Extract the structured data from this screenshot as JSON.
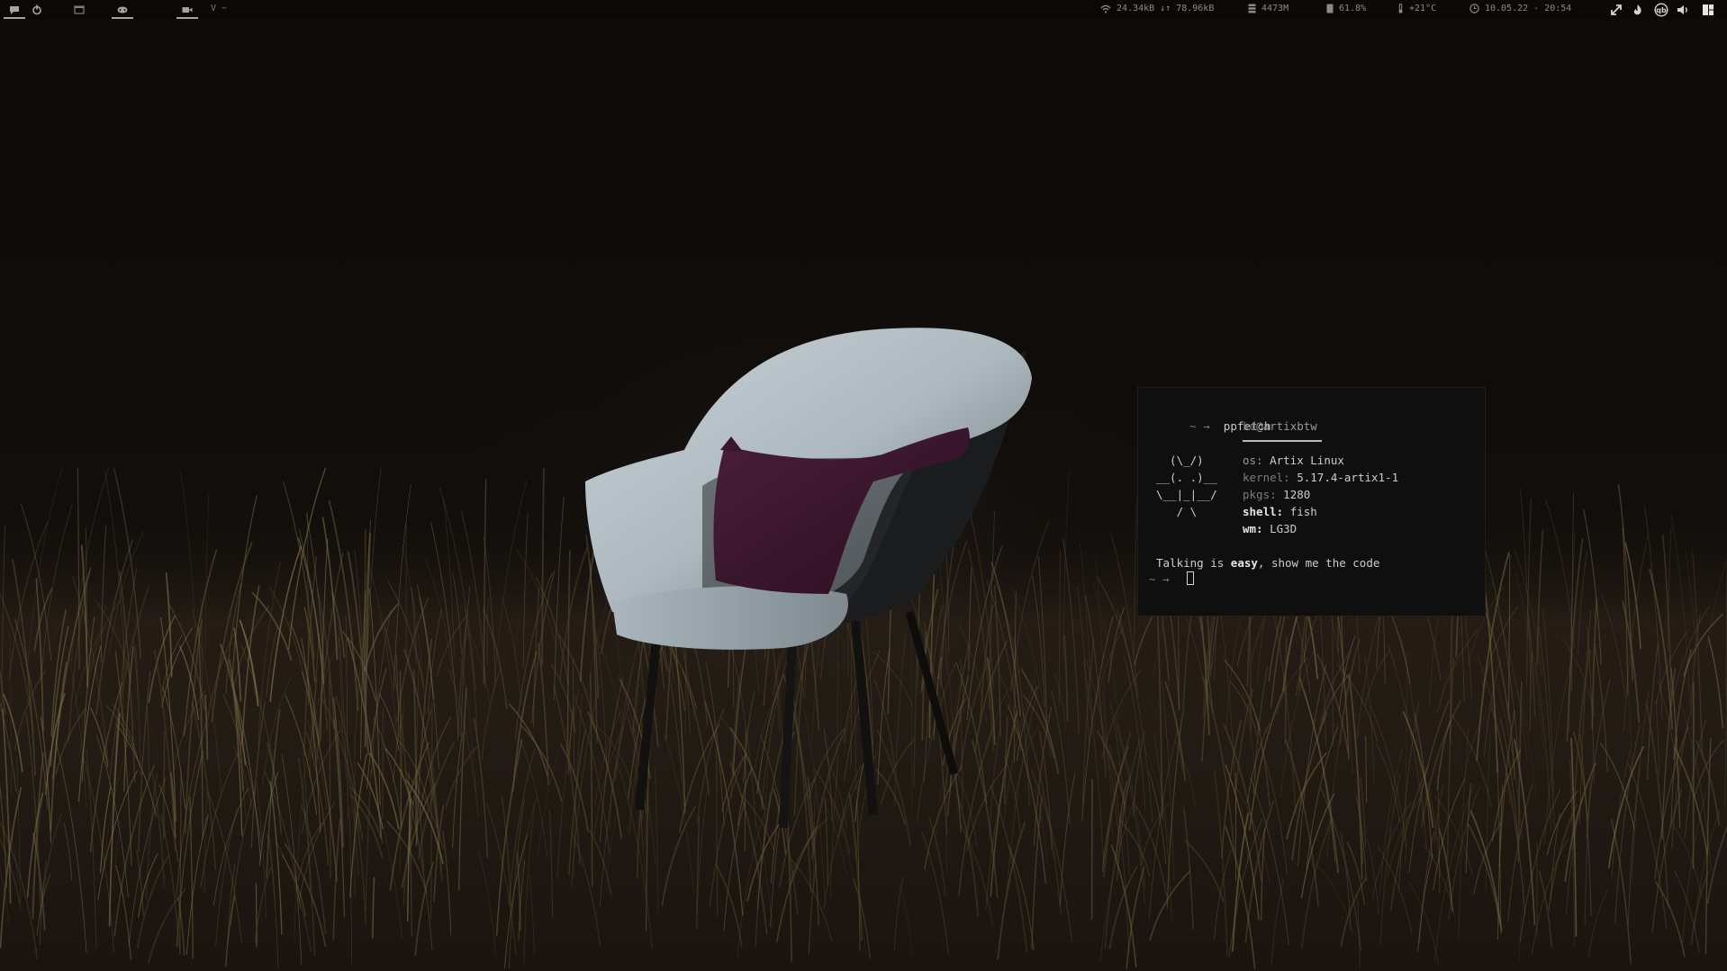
{
  "topbar": {
    "workspaces": [
      {
        "icon": "chat-icon",
        "active": true
      },
      {
        "icon": "power-icon",
        "active": false
      },
      {
        "icon": "window-icon",
        "active": false
      },
      {
        "icon": "game-icon",
        "active": true
      },
      {
        "icon": "video-icon",
        "active": true
      }
    ],
    "window_title": "V ~",
    "network": {
      "icon": "wifi-icon",
      "down": "24.34kB",
      "arrows": "↓↑",
      "up": "78.96kB"
    },
    "memory": {
      "icon": "memory-icon",
      "value": "4473M"
    },
    "disk": {
      "icon": "disk-icon",
      "value": "61.8%"
    },
    "temperature": {
      "icon": "thermometer-icon",
      "value": "+21°C"
    },
    "clock": {
      "icon": "clock-icon",
      "value": "10.05.22 - 20:54"
    },
    "tray": [
      "arrows-icon",
      "flame-icon",
      "qbittorrent-icon",
      "volume-icon",
      "layout-icon"
    ]
  },
  "terminal": {
    "prompt_symbol": "~ →",
    "command": "ppfetch",
    "user": "kd",
    "at_host": "@artixbtw",
    "ascii_art": [
      "  (\\_/)",
      "__(. .)__",
      "\\__|_|__/",
      "   / \\"
    ],
    "info": [
      {
        "key": "os:",
        "value": "Artix Linux",
        "style": "plain"
      },
      {
        "key": "kernel:",
        "value": "5.17.4-artix1-1",
        "style": "dim"
      },
      {
        "key": "pkgs:",
        "value": "1280",
        "style": "dim"
      },
      {
        "key": "shell:",
        "value": "fish",
        "style": "bold"
      },
      {
        "key": "wm:",
        "value": "LG3D",
        "style": "bold"
      }
    ],
    "quote_pre": "Talking is ",
    "quote_emph": "easy",
    "quote_post": ", show me the code",
    "prompt2": "~ →"
  }
}
